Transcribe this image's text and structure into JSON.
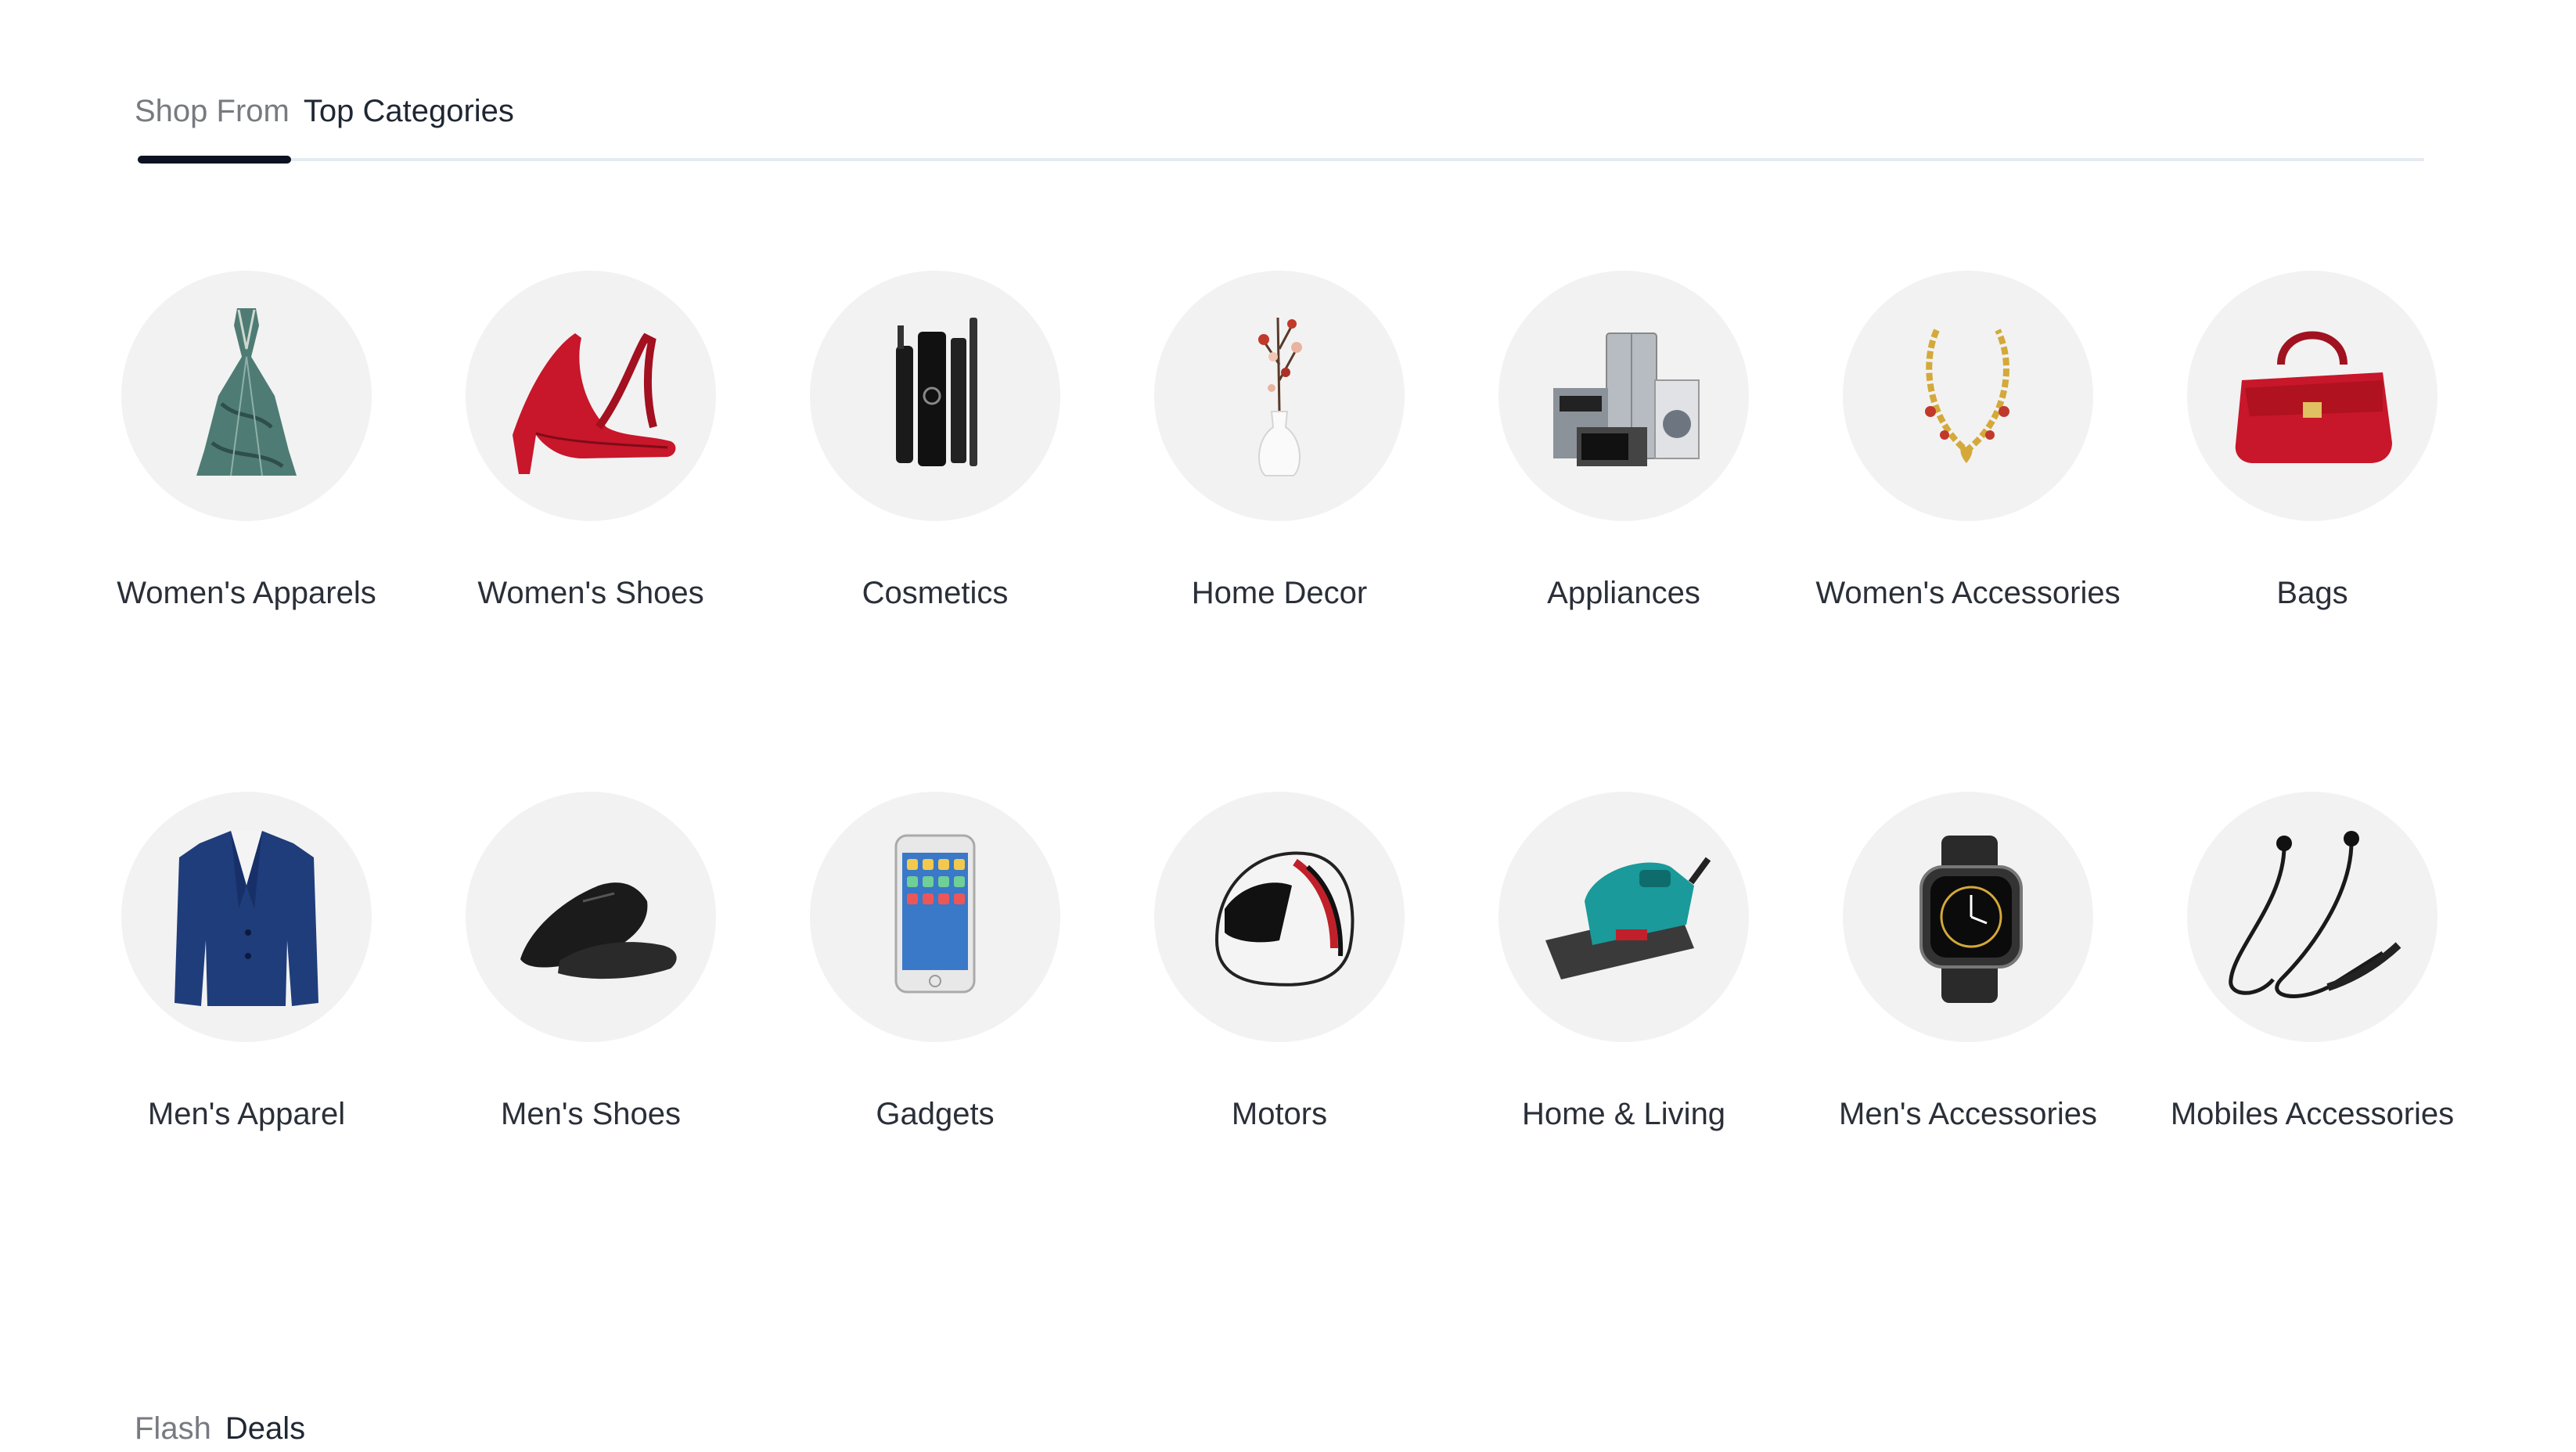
{
  "top_categories": {
    "prefix": "Shop From",
    "title": "Top Categories"
  },
  "categories": [
    {
      "label": "Women's Apparels",
      "icon": "dress-icon"
    },
    {
      "label": "Women's Shoes",
      "icon": "high-heel-icon"
    },
    {
      "label": "Cosmetics",
      "icon": "cosmetics-icon"
    },
    {
      "label": "Home Decor",
      "icon": "vase-icon"
    },
    {
      "label": "Appliances",
      "icon": "appliances-icon"
    },
    {
      "label": "Women's Accessories",
      "icon": "necklace-icon"
    },
    {
      "label": "Bags",
      "icon": "handbag-icon"
    },
    {
      "label": "Men's Apparel",
      "icon": "blazer-icon"
    },
    {
      "label": "Men's Shoes",
      "icon": "dress-shoes-icon"
    },
    {
      "label": "Gadgets",
      "icon": "smartphone-icon"
    },
    {
      "label": "Motors",
      "icon": "helmet-icon"
    },
    {
      "label": "Home & Living",
      "icon": "power-planer-icon"
    },
    {
      "label": "Men's Accessories",
      "icon": "smartwatch-icon"
    },
    {
      "label": "Mobiles Accessories",
      "icon": "earphones-icon"
    }
  ],
  "flash_deals": {
    "prefix": "Flash",
    "title": "Deals"
  }
}
